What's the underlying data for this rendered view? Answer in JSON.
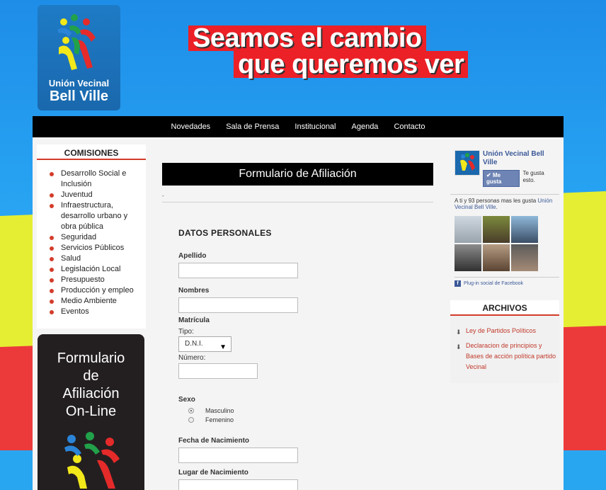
{
  "header": {
    "logo_line1": "Unión Vecinal",
    "logo_line2": "Bell Ville",
    "slogan_line1": "Seamos el cambio",
    "slogan_line2": "que queremos ver"
  },
  "nav": {
    "items": [
      "Novedades",
      "Sala de Prensa",
      "Institucional",
      "Agenda",
      "Contacto"
    ]
  },
  "comisiones": {
    "title": "COMISIONES",
    "items": [
      "Desarrollo Social e Inclusión",
      "Juventud",
      "Infraestructura, desarrollo urbano y obra pública",
      "Seguridad",
      "Servicios Públicos",
      "Salud",
      "Legislación Local",
      "Presupuesto",
      "Producción y empleo",
      "Medio Ambiente",
      "Eventos"
    ]
  },
  "promo": {
    "line1": "Formulario",
    "line2": "de",
    "line3": "Afiliación",
    "line4": "On-Line"
  },
  "form": {
    "title": "Formulario de Afiliación",
    "dash": "-",
    "section_title": "DATOS PERSONALES",
    "apellido_label": "Apellido",
    "nombres_label": "Nombres",
    "matricula_label": "Matrícula",
    "tipo_label": "Tipo:",
    "tipo_value": "D.N.I.",
    "numero_label": "Número:",
    "sexo_label": "Sexo",
    "sexo_options": [
      "Masculino",
      "Femenino"
    ],
    "fecha_label": "Fecha de Nacimiento",
    "lugar_label": "Lugar de Nacimiento"
  },
  "facebook": {
    "page_name": "Unión Vecinal Bell Ville",
    "like_label": "Me gusta",
    "like_text": "Te gusta esto.",
    "stats_prefix": "A ti y 93 personas mas les gusta",
    "stats_link": "Unión Vecinal Bell Ville",
    "stats_suffix": ".",
    "plugin_text": "Plug-in social de Facebook"
  },
  "archivos": {
    "title": "ARCHIVOS",
    "items": [
      "Ley de Partidos Políticos",
      "Declaracion de principios y Bases de acción política partido Vecinal"
    ]
  },
  "colors": {
    "accent_red": "#d33c2a",
    "facebook_blue": "#3b5998",
    "background_blue": "#27a3f2"
  }
}
